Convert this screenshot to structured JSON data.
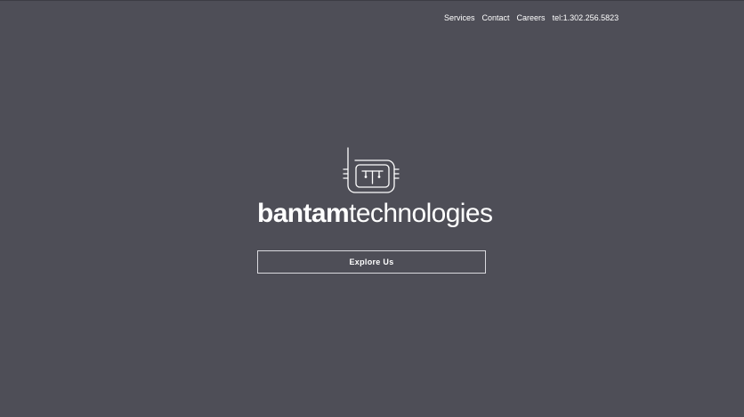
{
  "colors": {
    "background": "#4e4e57",
    "foreground": "#ffffff"
  },
  "nav": {
    "items": [
      {
        "label": "Services"
      },
      {
        "label": "Contact"
      },
      {
        "label": "Careers"
      },
      {
        "label": "tel:1.302.256.5823"
      }
    ]
  },
  "brand": {
    "logo_icon": "circuit-chip-t-icon",
    "name_bold": "bantam",
    "name_light": "technologies"
  },
  "hero": {
    "cta_label": "Explore Us"
  }
}
